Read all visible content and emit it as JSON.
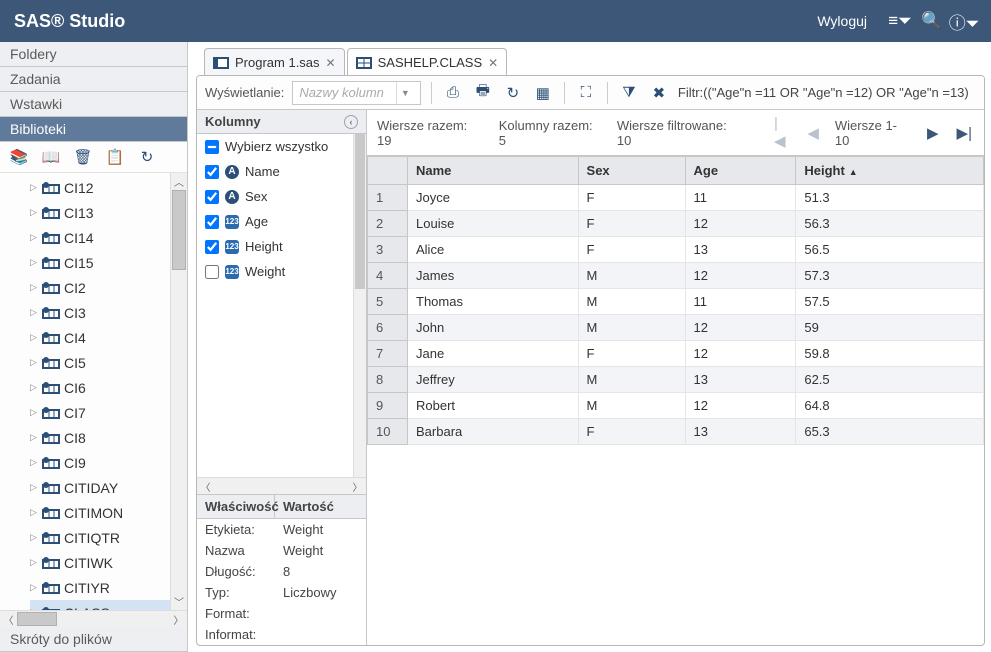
{
  "app": {
    "title": "SAS® Studio",
    "logout": "Wyloguj"
  },
  "left": {
    "sections": {
      "foldery": "Foldery",
      "zadania": "Zadania",
      "wstawki": "Wstawki",
      "biblioteki": "Biblioteki",
      "skroty": "Skróty do plików"
    },
    "tree": [
      "CI12",
      "CI13",
      "CI14",
      "CI15",
      "CI2",
      "CI3",
      "CI4",
      "CI5",
      "CI6",
      "CI7",
      "CI8",
      "CI9",
      "CITIDAY",
      "CITIMON",
      "CITIQTR",
      "CITIWK",
      "CITIYR",
      "CLASS"
    ]
  },
  "tabs": {
    "program": "Program 1.sas",
    "dataset": "SASHELP.CLASS"
  },
  "toolbar": {
    "view_label": "Wyświetlanie:",
    "dropdown_placeholder": "Nazwy kolumn",
    "filter_prefix": "Filtr:",
    "filter_expr": "((\"Age\"n =11 OR \"Age\"n =12) OR \"Age\"n =13)"
  },
  "info": {
    "rows_total_label": "Wiersze razem:",
    "rows_total": "19",
    "cols_total_label": "Kolumny razem:",
    "cols_total": "5",
    "rows_filtered_label": "Wiersze filtrowane:",
    "rows_filtered": "10",
    "page_label": "Wiersze 1-10"
  },
  "columns": {
    "header": "Kolumny",
    "select_all": "Wybierz wszystko",
    "items": [
      {
        "name": "Name",
        "type": "char",
        "checked": true
      },
      {
        "name": "Sex",
        "type": "char",
        "checked": true
      },
      {
        "name": "Age",
        "type": "num",
        "checked": true
      },
      {
        "name": "Height",
        "type": "num",
        "checked": true
      },
      {
        "name": "Weight",
        "type": "num",
        "checked": false
      }
    ]
  },
  "props": {
    "h1": "Właściwość",
    "h2": "Wartość",
    "rows": {
      "etykieta_k": "Etykieta:",
      "etykieta_v": "Weight",
      "nazwa_k": "Nazwa",
      "nazwa_v": "Weight",
      "dlugosc_k": "Długość:",
      "dlugosc_v": "8",
      "typ_k": "Typ:",
      "typ_v": "Liczbowy",
      "format_k": "Format:",
      "format_v": "",
      "informat_k": "Informat:",
      "informat_v": ""
    }
  },
  "chart_data": {
    "type": "table",
    "columns": [
      "Name",
      "Sex",
      "Age",
      "Height"
    ],
    "rows": [
      {
        "n": "1",
        "Name": "Joyce",
        "Sex": "F",
        "Age": "11",
        "Height": "51.3"
      },
      {
        "n": "2",
        "Name": "Louise",
        "Sex": "F",
        "Age": "12",
        "Height": "56.3"
      },
      {
        "n": "3",
        "Name": "Alice",
        "Sex": "F",
        "Age": "13",
        "Height": "56.5"
      },
      {
        "n": "4",
        "Name": "James",
        "Sex": "M",
        "Age": "12",
        "Height": "57.3"
      },
      {
        "n": "5",
        "Name": "Thomas",
        "Sex": "M",
        "Age": "11",
        "Height": "57.5"
      },
      {
        "n": "6",
        "Name": "John",
        "Sex": "M",
        "Age": "12",
        "Height": "59"
      },
      {
        "n": "7",
        "Name": "Jane",
        "Sex": "F",
        "Age": "12",
        "Height": "59.8"
      },
      {
        "n": "8",
        "Name": "Jeffrey",
        "Sex": "M",
        "Age": "13",
        "Height": "62.5"
      },
      {
        "n": "9",
        "Name": "Robert",
        "Sex": "M",
        "Age": "12",
        "Height": "64.8"
      },
      {
        "n": "10",
        "Name": "Barbara",
        "Sex": "F",
        "Age": "13",
        "Height": "65.3"
      }
    ]
  }
}
